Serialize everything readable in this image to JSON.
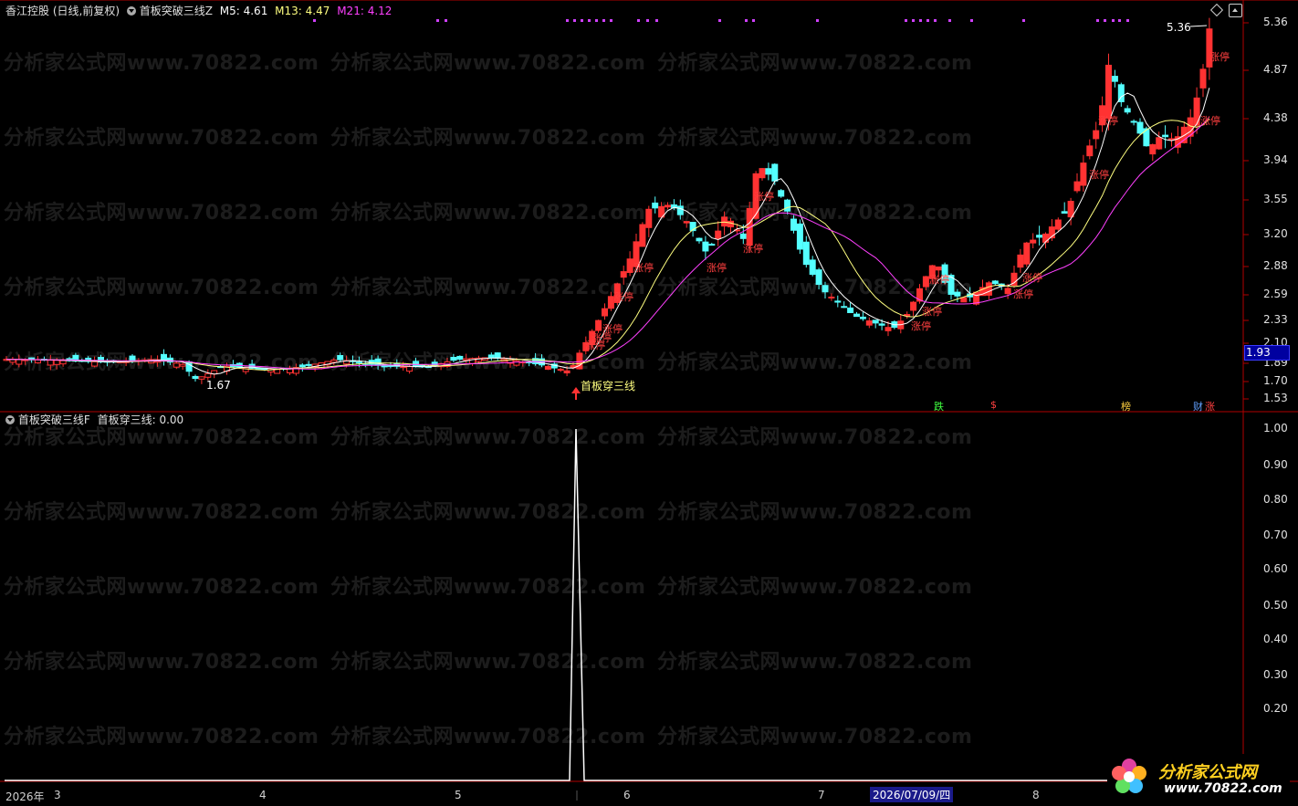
{
  "header": {
    "stock_name": "香江控股",
    "period": "(日线,前复权)",
    "indicator_name": "首板突破三线Z",
    "ma5_label": "M5:",
    "ma5_value": "4.61",
    "ma13_label": "M13:",
    "ma13_value": "4.47",
    "ma21_label": "M21:",
    "ma21_value": "4.12"
  },
  "sub_header": {
    "indicator_name": "首板突破三线F",
    "signal_label": "首板穿三线:",
    "signal_value": "0.00"
  },
  "price_axis": [
    "5.36",
    "4.87",
    "4.38",
    "3.94",
    "3.55",
    "3.20",
    "2.88",
    "2.59",
    "2.33",
    "2.10",
    "1.89",
    "1.70",
    "1.53"
  ],
  "current_price": "1.93",
  "sub_axis": [
    "1.00",
    "0.90",
    "0.80",
    "0.70",
    "0.60",
    "0.50",
    "0.40",
    "0.30",
    "0.20"
  ],
  "annotations": {
    "low_price": "1.67",
    "high_price": "5.36",
    "signal_text": "首板穿三线",
    "limit_up": "涨停"
  },
  "event_marks": {
    "m1": "跌",
    "m2": "$",
    "m3": "榜",
    "m4": "财",
    "m5": "涨"
  },
  "date_axis": {
    "year": "2026年",
    "m3": "3",
    "m4": "4",
    "m5": "5",
    "m6": "6",
    "m7": "7",
    "cursor_date": "2026/07/09/四",
    "m8": "8"
  },
  "watermark": "分析家公式网www.70822.com",
  "logo": {
    "text": "分析家公式网",
    "url": "www.70822.com"
  },
  "colors": {
    "up": "#ff3232",
    "down": "#54ffff",
    "ma5": "#ffffff",
    "ma13": "#ffff80",
    "ma21": "#ff40ff",
    "panel_border": "#b00000"
  }
}
